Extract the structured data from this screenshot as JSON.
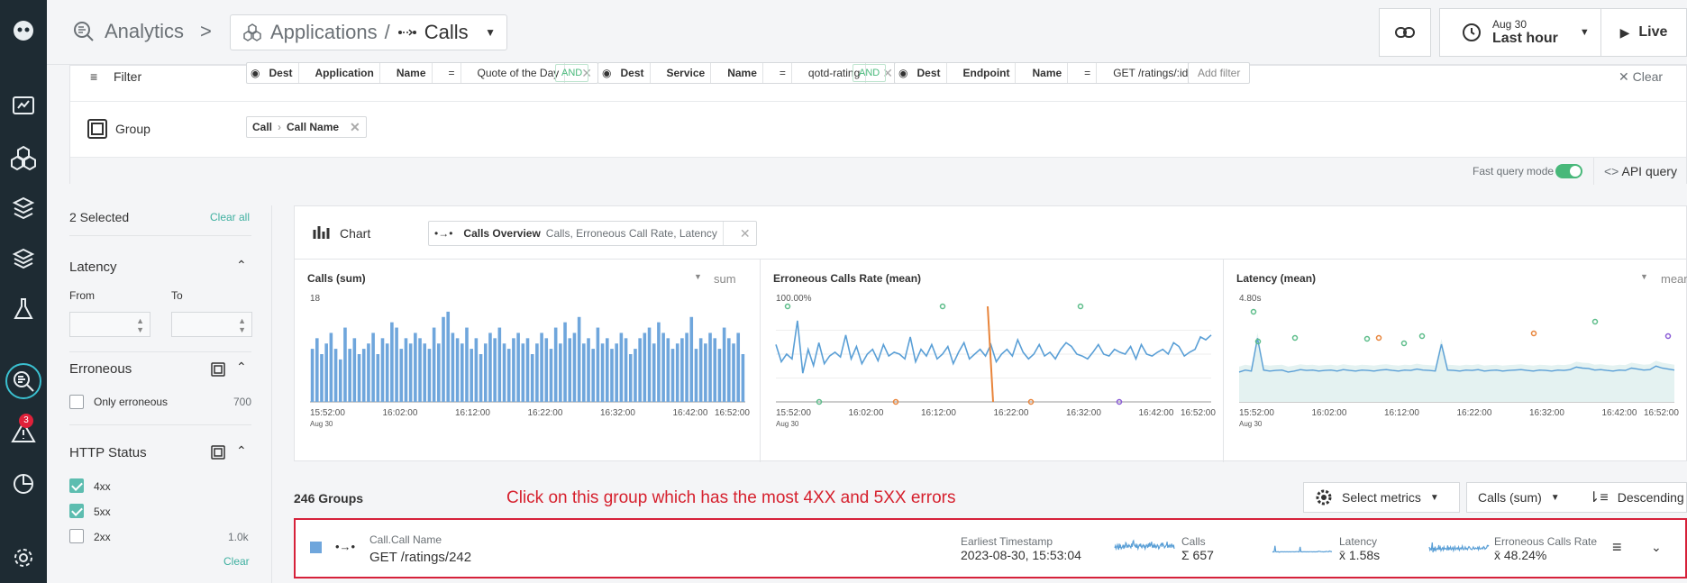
{
  "header": {
    "analytics_label": "Analytics",
    "breadcrumb_sep": ">",
    "applications_label": "Applications",
    "path_sep": "/",
    "calls_label": "Calls",
    "date_small": "Aug 30",
    "time_range": "Last hour",
    "live_label": "Live"
  },
  "rail": {
    "alerts_badge": "3"
  },
  "filters": {
    "filter_label": "Filter",
    "group_label": "Group",
    "clear_label": "Clear",
    "add_filter": "Add filter",
    "and": "AND",
    "chips": [
      {
        "dir": "Dest",
        "entity": "Application",
        "prop": "Name",
        "op": "=",
        "value": "Quote of the Day"
      },
      {
        "dir": "Dest",
        "entity": "Service",
        "prop": "Name",
        "op": "=",
        "value": "qotd-rating"
      },
      {
        "dir": "Dest",
        "entity": "Endpoint",
        "prop": "Name",
        "op": "=",
        "value": "GET /ratings/:id"
      }
    ],
    "group_chip": {
      "a": "Call",
      "b": "Call Name"
    },
    "fast_query_mode": "Fast query mode",
    "api_query": "API query"
  },
  "sidebar": {
    "selected": "2 Selected",
    "clear_all": "Clear all",
    "latency": "Latency",
    "from": "From",
    "to": "To",
    "erroneous": "Erroneous",
    "only_erroneous": "Only erroneous",
    "only_erroneous_count": "700",
    "http_status": "HTTP Status",
    "statuses": [
      {
        "label": "4xx",
        "count": "",
        "checked": true
      },
      {
        "label": "5xx",
        "count": "",
        "checked": true
      },
      {
        "label": "2xx",
        "count": "1.0k",
        "checked": false
      }
    ],
    "clear": "Clear"
  },
  "chart": {
    "label": "Chart",
    "overview_chip": "Calls Overview",
    "overview_detail": "Calls, Erroneous Call Rate, Latency",
    "panels": [
      {
        "title": "Calls (sum)",
        "agg": "sum",
        "ymax_label": "18"
      },
      {
        "title": "Erroneous Calls Rate (mean)",
        "agg": "",
        "ymax_label": "100.00%"
      },
      {
        "title": "Latency (mean)",
        "agg": "mean",
        "ymax_label": "4.80s"
      }
    ],
    "x_ticks": [
      "15:52:00",
      "16:02:00",
      "16:12:00",
      "16:22:00",
      "16:32:00",
      "16:42:00",
      "16:52:00"
    ],
    "x_sub": "Aug 30"
  },
  "chart_data": [
    {
      "type": "bar",
      "title": "Calls (sum)",
      "ylim": [
        0,
        18
      ],
      "values": [
        10,
        12,
        9,
        11,
        13,
        10,
        8,
        14,
        10,
        12,
        9,
        10,
        11,
        13,
        9,
        12,
        11,
        15,
        14,
        10,
        12,
        11,
        13,
        12,
        11,
        10,
        14,
        11,
        16,
        17,
        13,
        12,
        11,
        14,
        10,
        12,
        9,
        11,
        13,
        12,
        14,
        11,
        10,
        12,
        13,
        11,
        12,
        9,
        11,
        13,
        12,
        10,
        14,
        11,
        15,
        12,
        13,
        16,
        11,
        12,
        10,
        14,
        11,
        12,
        10,
        11,
        13,
        12,
        9,
        10,
        12,
        13,
        14,
        11,
        15,
        13,
        12,
        10,
        11,
        12,
        13,
        16,
        10,
        12,
        11,
        13,
        12,
        10,
        14,
        12,
        11,
        13,
        9
      ]
    },
    {
      "type": "line",
      "title": "Erroneous Calls Rate (mean)",
      "ylim": [
        0,
        100
      ],
      "unit": "%",
      "values": [
        60,
        42,
        50,
        45,
        85,
        30,
        55,
        38,
        62,
        40,
        48,
        52,
        47,
        70,
        45,
        58,
        40,
        50,
        55,
        43,
        60,
        48,
        52,
        50,
        45,
        68,
        42,
        55,
        48,
        60,
        45,
        50,
        58,
        40,
        52,
        62,
        45,
        50,
        55,
        48,
        60,
        42,
        50,
        55,
        48,
        65,
        52,
        45,
        50,
        60,
        48,
        52,
        45,
        55,
        62,
        58,
        50,
        48,
        45,
        52,
        60,
        50,
        48,
        55,
        52,
        50,
        58,
        45,
        60,
        50,
        48,
        52,
        55,
        50,
        62,
        58,
        48,
        52,
        55,
        68,
        65,
        70
      ]
    },
    {
      "type": "line",
      "title": "Latency (mean)",
      "ylim": [
        0,
        4.8
      ],
      "unit": "s",
      "values": [
        1.5,
        1.6,
        1.55,
        3.2,
        1.6,
        1.55,
        1.58,
        1.6,
        1.5,
        1.55,
        1.62,
        1.58,
        1.6,
        1.55,
        1.58,
        1.6,
        1.55,
        1.62,
        1.58,
        1.55,
        1.6,
        1.58,
        1.55,
        1.6,
        1.62,
        1.58,
        1.55,
        1.6,
        1.58,
        1.65,
        1.6,
        1.58,
        1.55,
        2.9,
        1.6,
        1.58,
        1.55,
        1.6,
        1.58,
        1.62,
        1.55,
        1.58,
        1.6,
        1.55,
        1.58,
        1.6,
        1.62,
        1.58,
        1.55,
        1.6,
        1.58,
        1.55,
        1.6,
        1.58,
        1.62,
        1.75,
        1.7,
        1.68,
        1.6,
        1.62,
        1.58,
        1.55,
        1.6,
        1.58,
        1.7,
        1.65,
        1.6,
        1.62,
        1.8,
        1.7,
        1.65,
        1.6
      ]
    }
  ],
  "groups": {
    "count_label": "246 Groups",
    "instruction": "Click on this group which has the most 4XX and 5XX errors",
    "select_metrics": "Select metrics",
    "sort_metric": "Calls (sum)",
    "sort_order": "Descending",
    "row": {
      "name_label": "Call.Call Name",
      "name_value": "GET /ratings/242",
      "ts_label": "Earliest Timestamp",
      "ts_value": "2023-08-30, 15:53:04",
      "calls_label": "Calls",
      "calls_value": "Σ 657",
      "latency_label": "Latency",
      "latency_value": "x̄ 1.58s",
      "err_label": "Erroneous Calls Rate",
      "err_value": "x̄ 48.24%"
    }
  },
  "colors": {
    "accent": "#5dbdb0",
    "bar": "#6fa6dc",
    "error": "#d6212e",
    "rail": "#1e2b33"
  }
}
